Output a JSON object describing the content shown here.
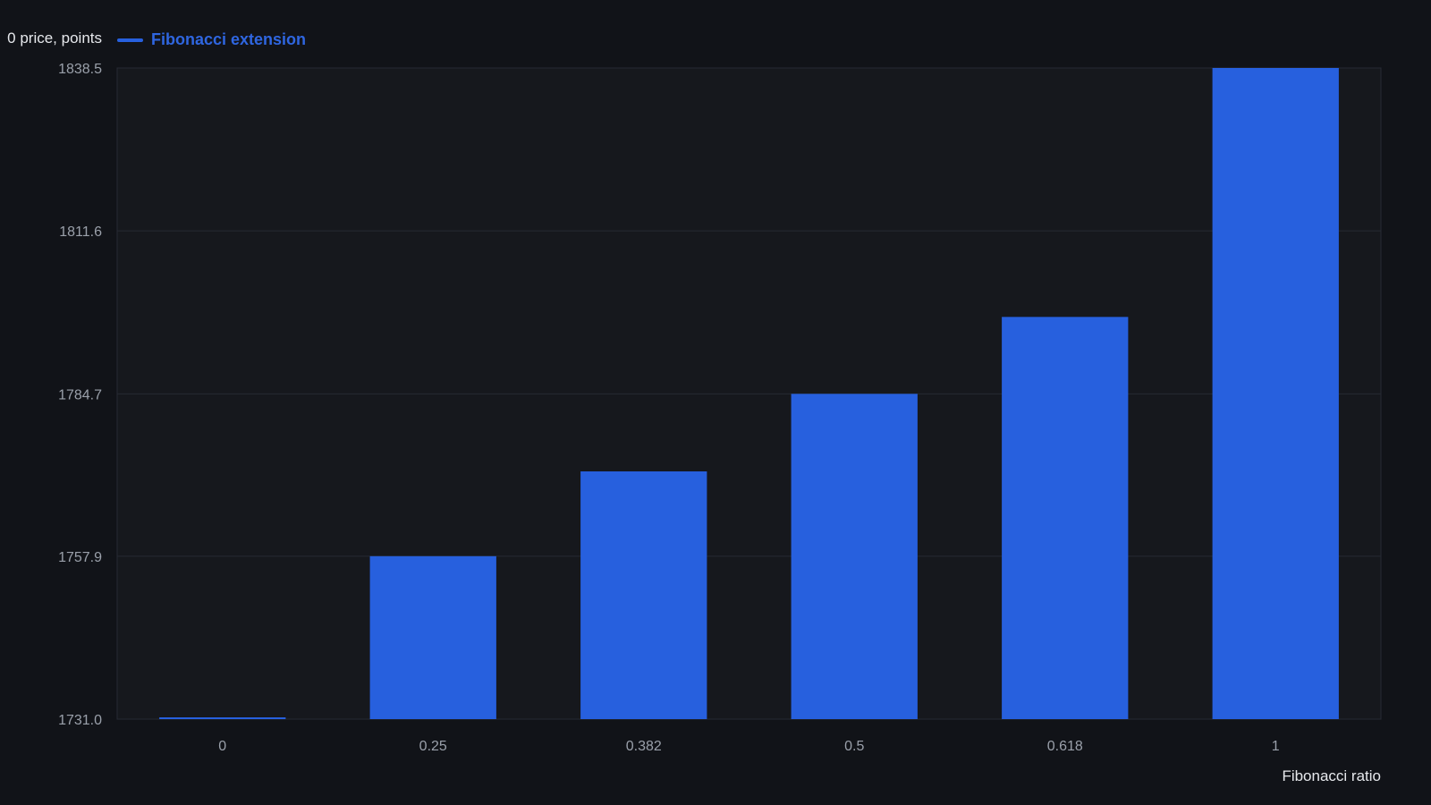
{
  "chart_data": {
    "type": "bar",
    "title": "",
    "ylabel": "0 price, points",
    "xlabel": "Fibonacci ratio",
    "categories": [
      "0",
      "0.25",
      "0.382",
      "0.5",
      "0.618",
      "1"
    ],
    "series": [
      {
        "name": "Fibonacci extension",
        "values": [
          1731.0,
          1757.9,
          1771.9,
          1784.7,
          1797.4,
          1838.5
        ]
      }
    ],
    "ylim": [
      1731.0,
      1838.5
    ],
    "yticks": [
      "1731.0",
      "1757.9",
      "1784.7",
      "1811.6",
      "1838.5"
    ],
    "grid": true,
    "legend_position": "top-left",
    "colors": {
      "background": "#111318",
      "plot_background": "#16181d",
      "bar": "#2760de",
      "legend_text": "#2f66e0",
      "grid": "#262a33",
      "tick_text": "#9aa0aa"
    }
  }
}
